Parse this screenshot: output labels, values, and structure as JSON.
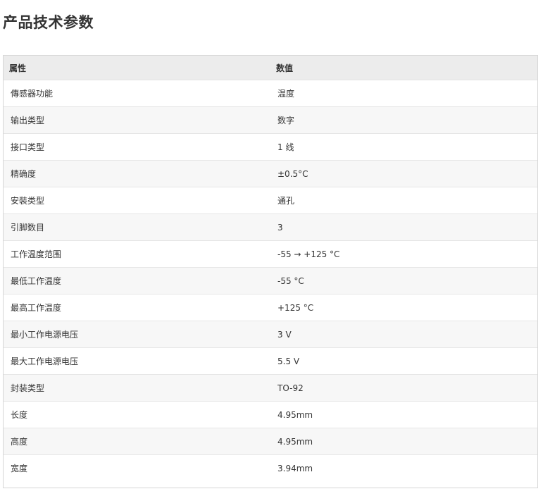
{
  "page": {
    "title": "产品技术参数"
  },
  "table": {
    "headers": [
      "属性",
      "数值"
    ],
    "rows": [
      [
        "傳感器功能",
        "温度"
      ],
      [
        "输出类型",
        "数字"
      ],
      [
        "接口类型",
        "1 线"
      ],
      [
        "精确度",
        "±0.5°C"
      ],
      [
        "安裝类型",
        "通孔"
      ],
      [
        "引脚数目",
        "3"
      ],
      [
        "工作温度范围",
        "-55 → +125 °C"
      ],
      [
        "最低工作温度",
        "-55 °C"
      ],
      [
        "最高工作温度",
        "+125 °C"
      ],
      [
        "最小工作电源电压",
        "3 V"
      ],
      [
        "最大工作电源电压",
        "5.5 V"
      ],
      [
        "封装类型",
        "TO-92"
      ],
      [
        "长度",
        "4.95mm"
      ],
      [
        "高度",
        "4.95mm"
      ],
      [
        "宽度",
        "3.94mm"
      ]
    ]
  }
}
